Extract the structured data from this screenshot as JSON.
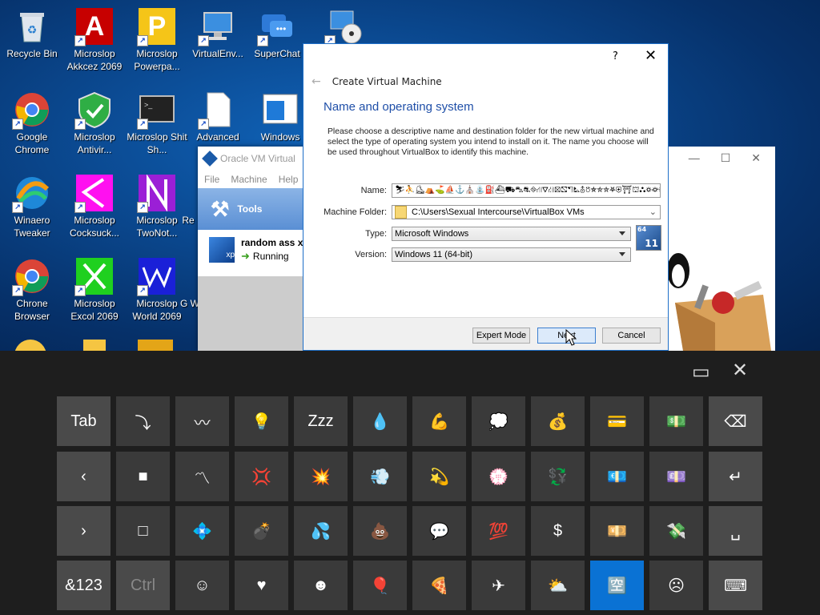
{
  "desktop": {
    "icons": [
      {
        "label": "Recycle Bin",
        "icon": "recycle-bin-icon"
      },
      {
        "label": "Microslop Akkcez 2069",
        "icon": "access-icon",
        "glyph": "A",
        "color": "#d40000"
      },
      {
        "label": "Microslop Powerpa...",
        "icon": "powerpoint-icon",
        "glyph": "P",
        "color": "#f7c21a"
      },
      {
        "label": "VirtualEnv...",
        "icon": "virtual-env-icon"
      },
      {
        "label": "SuperChat",
        "icon": "superchat-icon"
      },
      {
        "label": "Google Chrome",
        "icon": "chrome-icon"
      },
      {
        "label": "Microslop Antivir...",
        "icon": "antivirus-icon"
      },
      {
        "label": "Microslop Shit Sh...",
        "icon": "terminal-icon"
      },
      {
        "label": "Advanced",
        "icon": "document-icon"
      },
      {
        "label": "Windows",
        "icon": "windows-app-icon"
      },
      {
        "label": "Winaero Tweaker",
        "icon": "winaero-icon"
      },
      {
        "label": "Microslop Cocksuck...",
        "icon": "magenta-app-icon"
      },
      {
        "label": "Microslop TwoNot...",
        "icon": "onenote-icon"
      },
      {
        "label": "Re",
        "icon": "partial-icon"
      },
      {
        "label": "Chrone Browser",
        "icon": "chrome-icon"
      },
      {
        "label": "Microslop Excol 2069",
        "icon": "excel-icon"
      },
      {
        "label": "Microslop World 2069",
        "icon": "word-icon"
      },
      {
        "label": "G W",
        "icon": "partial-icon"
      }
    ]
  },
  "vbox_manager": {
    "title": "Oracle VM Virtual",
    "menu": [
      "File",
      "Machine",
      "Help"
    ],
    "tools_label": "Tools",
    "vm_name": "random ass x",
    "vm_state": "Running"
  },
  "dialog": {
    "help": "?",
    "close": "✕",
    "back": "←",
    "title": "Create Virtual Machine",
    "heading": "Name and operating system",
    "description": "Please choose a descriptive name and destination folder for the new virtual machine and select the type of operating system you intend to install on it. The name you choose will be used throughout VirtualBox to identify this machine.",
    "name_label": "Name:",
    "name_value": "⛷⛹⛸⛺⛳⛵⚓⛪⛲⛽⛴⛟⛍⛐⛗⛙⛛⛜⛝⛞⛠⛡⛢⛣⛤⛥⛦⛧⛨⛩⛫⛬⛭⛮⛯⛰",
    "folder_label": "Machine Folder:",
    "folder_value": "C:\\Users\\Sexual Intercourse\\VirtualBox VMs",
    "type_label": "Type:",
    "type_value": "Microsoft Windows",
    "version_label": "Version:",
    "version_value": "Windows 11 (64-bit)",
    "os_badge": "11",
    "os_badge_bits": "64",
    "buttons": {
      "expert": "Expert Mode",
      "next": "Next",
      "cancel": "Cancel"
    }
  },
  "keyboard": {
    "rows": [
      [
        "Tab",
        "⤵",
        "〰",
        "💡",
        "Zzz",
        "💧",
        "💪",
        "💭",
        "💰",
        "💳",
        "💵",
        "⌫"
      ],
      [
        "‹",
        "■",
        "〽",
        "💢",
        "💥",
        "💨",
        "💫",
        "💮",
        "💱",
        "💶",
        "💷",
        "↵"
      ],
      [
        "›",
        "□",
        "💠",
        "💣",
        "💦",
        "💩",
        "💬",
        "💯",
        "$",
        "💴",
        "💸",
        "␣"
      ],
      [
        "&123",
        "Ctrl",
        "☺",
        "♥",
        "☻",
        "🎈",
        "🍕",
        "✈",
        "⛅",
        "🈳",
        "☹",
        "⌨"
      ]
    ],
    "top_icons": {
      "dock": "▭",
      "close": "✕"
    }
  }
}
